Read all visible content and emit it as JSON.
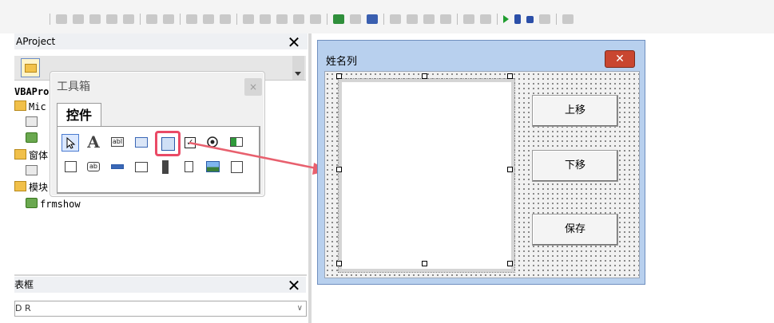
{
  "project_explorer": {
    "title": "AProject",
    "tree": [
      "VBAPro",
      "Mic",
      "",
      "",
      "窗体",
      "",
      "模块",
      "frmshow"
    ]
  },
  "properties": {
    "title": "表框",
    "combo_value": "  D  R   "
  },
  "toolbox": {
    "title": "工具箱",
    "close_glyph": "×",
    "tab_label": "控件",
    "tool_A": "A",
    "tool_textbox": "abl",
    "tool_button": "ab"
  },
  "userform": {
    "title": "姓名列",
    "close_glyph": "✕",
    "buttons": {
      "move_up": "上移",
      "move_down": "下移",
      "save": "保存"
    }
  },
  "colors": {
    "arrow": "#e8606e",
    "highlight": "#ea4a66",
    "form_title_bar": "#b8d0ee",
    "close_button": "#c94630"
  }
}
